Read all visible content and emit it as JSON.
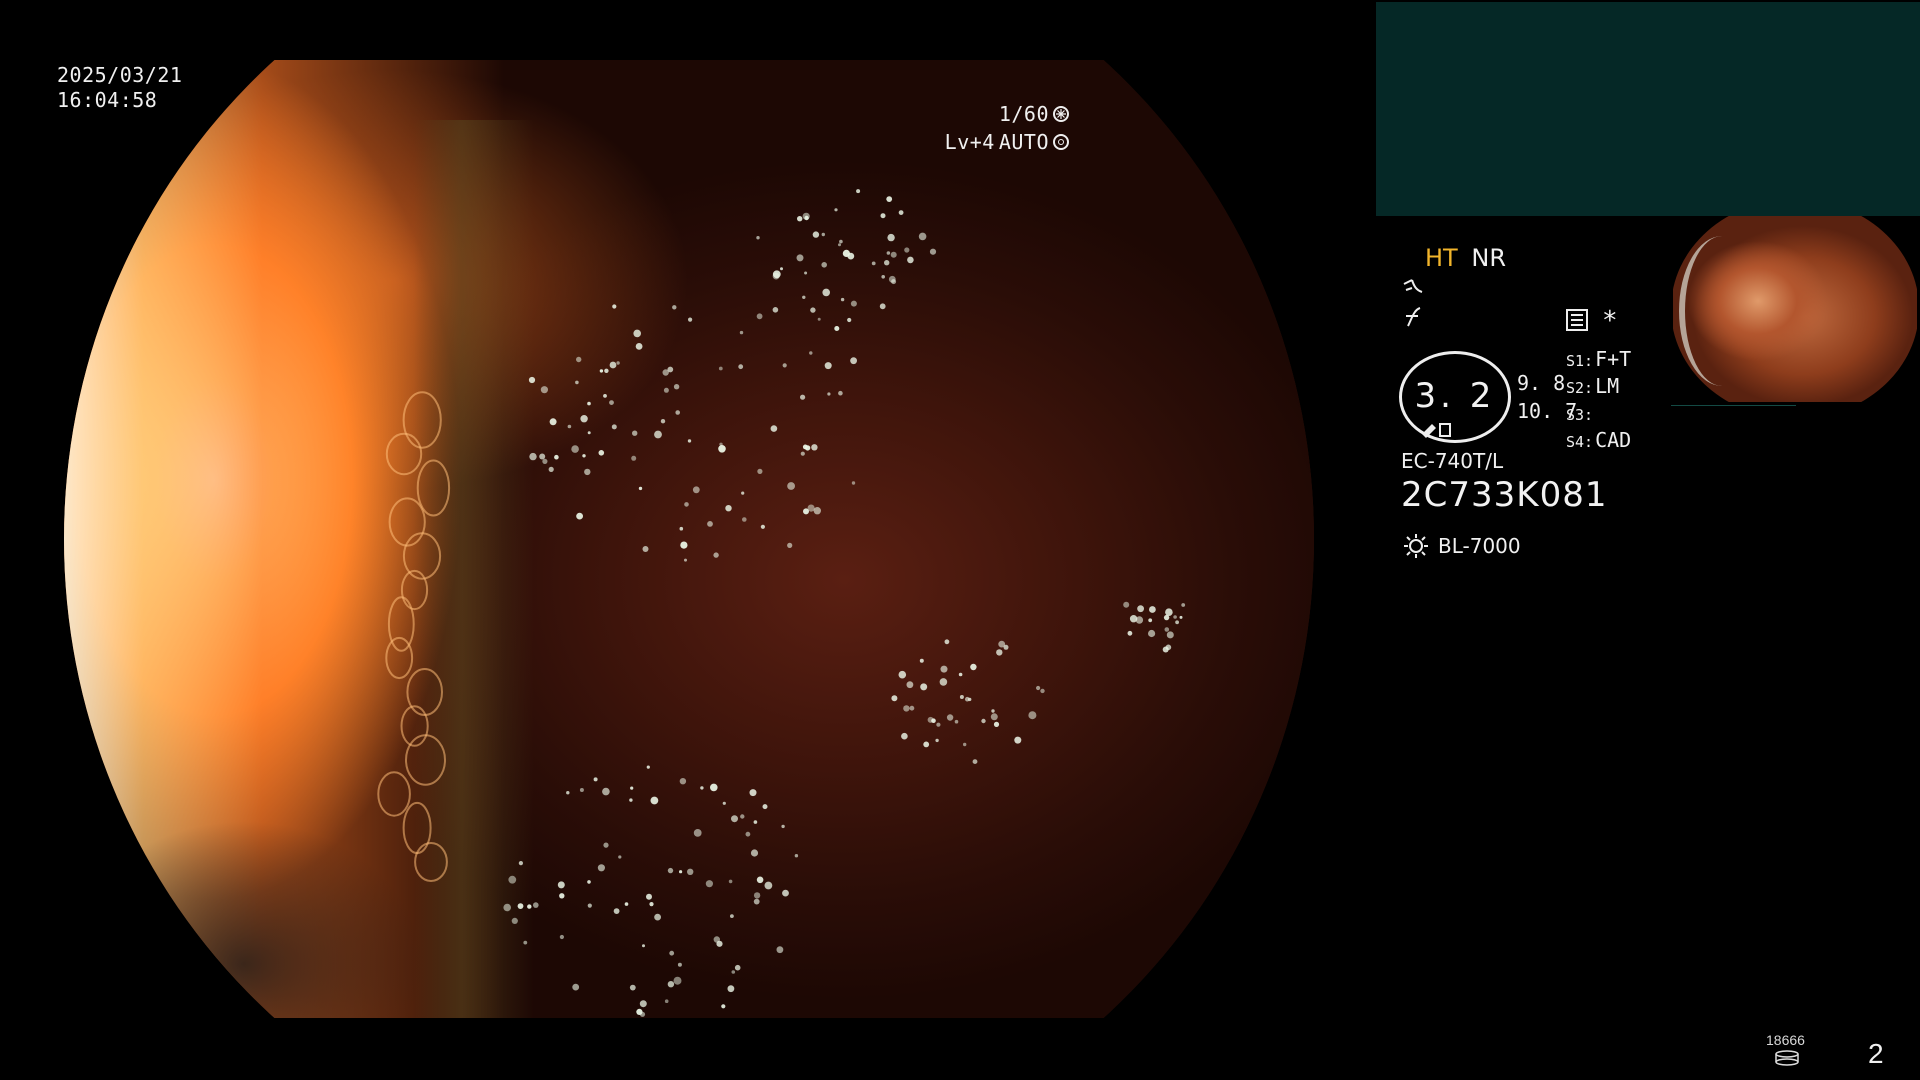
{
  "scope_view": {
    "date": "2025/03/21",
    "time": "16:04:58",
    "shutter": "1/60",
    "level": "Lv+4",
    "mode": "AUTO"
  },
  "panel": {
    "mode_ht": "HT",
    "mode_nr": "NR",
    "dial_value": "3. 2",
    "side_value_1": "9. 8",
    "side_value_2": "10. 7",
    "asterisk": "*",
    "switches": [
      {
        "key": "S1:",
        "value": "F+T"
      },
      {
        "key": "S2:",
        "value": "LM"
      },
      {
        "key": "S3:",
        "value": ""
      },
      {
        "key": "S4:",
        "value": "CAD"
      }
    ],
    "scope_model": "EC-740T/L",
    "serial": "2C733K081",
    "light_source": "BL-7000"
  },
  "footer": {
    "counter": "18666",
    "page": "2"
  },
  "colors": {
    "accent_ht": "#f2b52b",
    "top_box": "#052826",
    "text": "#f0f0f0"
  },
  "icons": [
    "shutter-icon",
    "auto-iris-icon",
    "curve-icon",
    "enhance-icon",
    "settings-list-icon",
    "light-source-icon",
    "storage-icon"
  ]
}
